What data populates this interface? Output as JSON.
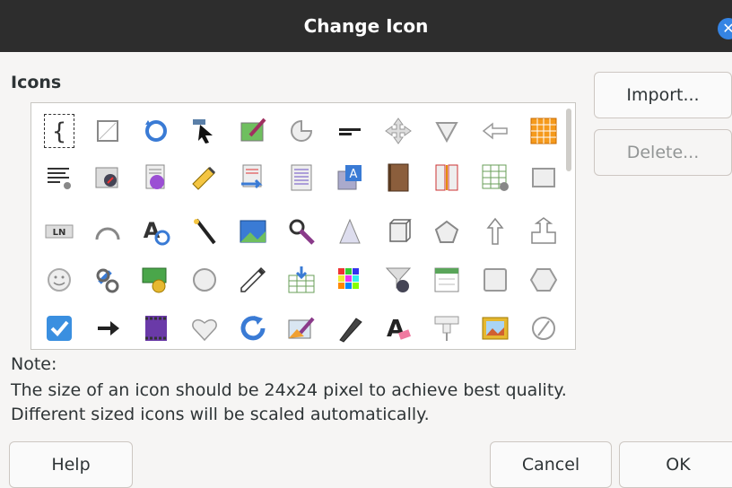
{
  "window": {
    "title": "Change Icon"
  },
  "icons_section": {
    "label": "Icons"
  },
  "icon_grid": [
    [
      "curly-bracket-icon",
      "square-icon",
      "rotate-3d-icon",
      "select-cursor-icon",
      "draw-on-image-icon",
      "pie-arc-icon",
      "horizontal-line-icon",
      "move-arrows-icon",
      "triangle-down-icon",
      "arrow-left-icon",
      "table-grid-icon"
    ],
    [
      "paragraph-settings-icon",
      "navigator-image-icon",
      "text-frame-icon",
      "highlight-pen-icon",
      "record-changes-icon",
      "text-document-icon",
      "text-box-icon",
      "book-icon",
      "column-break-icon",
      "table-settings-icon",
      "rectangle-icon"
    ],
    [
      "line-numbering-icon",
      "arc-icon",
      "autocorrect-icon",
      "magic-wand-icon",
      "image-icon",
      "zoom-pen-icon",
      "cone-icon",
      "cube-icon",
      "pentagon-icon",
      "arrow-up-icon",
      "up-arrow-block-icon"
    ],
    [
      "smiley-icon",
      "hyperlink-icon",
      "money-icon",
      "circle-icon",
      "eyedropper-icon",
      "table-insert-icon",
      "color-palette-icon",
      "filter-navigator-icon",
      "form-window-icon",
      "rounded-square-icon",
      "hexagon-icon"
    ],
    [
      "checkbox-icon",
      "arrow-right-icon",
      "film-frame-icon",
      "heart-icon",
      "refresh-icon",
      "edit-image-icon",
      "pen-icon",
      "clear-formatting-icon",
      "pushpin-icon",
      "image-frame-icon",
      "circle-slash-icon"
    ]
  ],
  "buttons": {
    "import": "Import...",
    "delete": "Delete...",
    "help": "Help",
    "cancel": "Cancel",
    "ok": "OK"
  },
  "note": {
    "heading": "Note:",
    "line1": "The size of an icon should be 24x24 pixel to achieve best quality.",
    "line2": "Different sized icons will be scaled automatically."
  }
}
